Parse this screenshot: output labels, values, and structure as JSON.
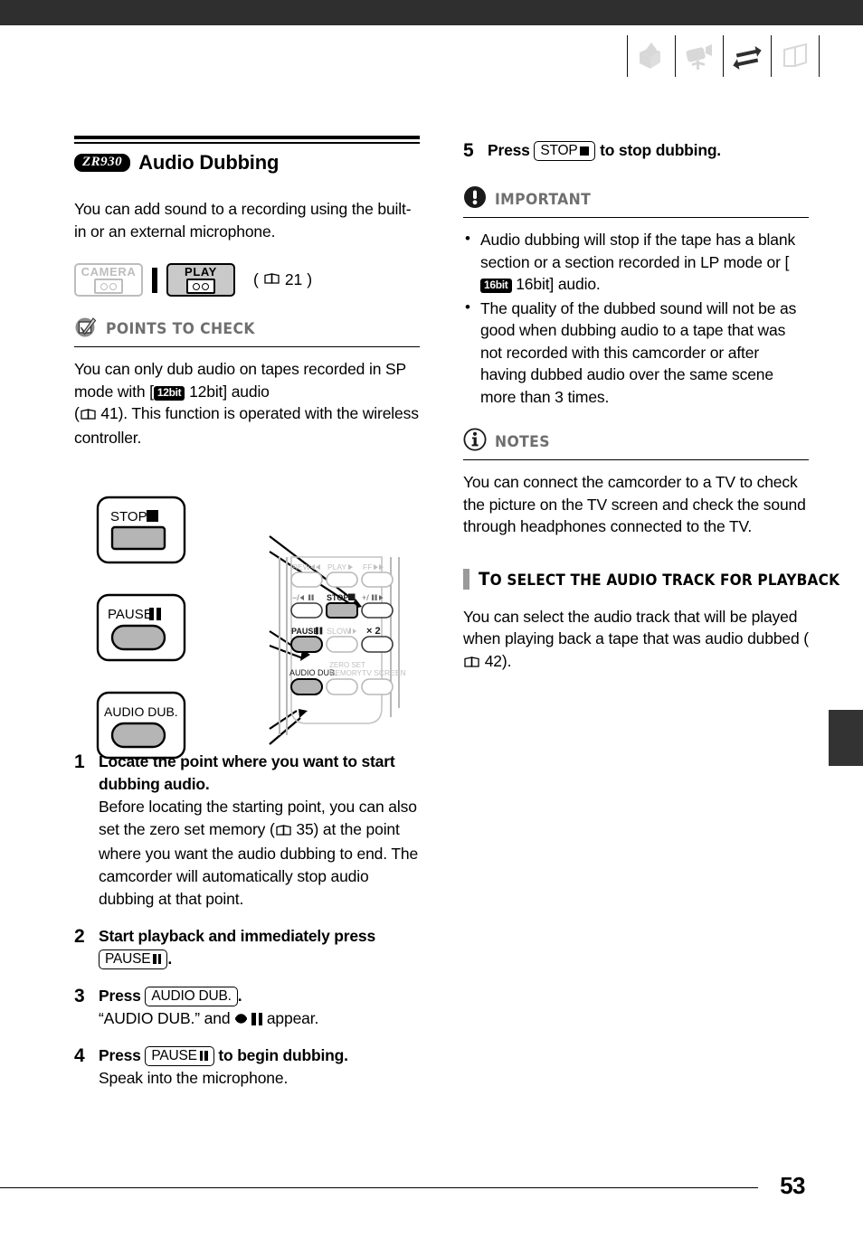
{
  "page": {
    "number": "53",
    "header_icons": [
      {
        "name": "unpack-box-icon",
        "state": "inactive"
      },
      {
        "name": "camcorder-icon",
        "state": "inactive"
      },
      {
        "name": "transfer-arrows-icon",
        "state": "active"
      },
      {
        "name": "open-book-icon",
        "state": "inactive"
      }
    ]
  },
  "left": {
    "model_badge": "ZR930",
    "section_title": "Audio Dubbing",
    "intro": "You can add sound to a recording using the built-in or an external microphone.",
    "modes": {
      "camera_label": "CAMERA",
      "play_label": "PLAY",
      "active": "PLAY",
      "page_ref": "21",
      "paren_open": "(",
      "paren_close": ")"
    },
    "points_to_check": {
      "heading": "POINTS TO CHECK",
      "icon": "checkbox-check-icon",
      "text_a": "You can only dub audio on tapes recorded in SP mode with [",
      "badge": "12bit",
      "text_b": " 12bit] audio",
      "text_c": "(",
      "page_ref": "41",
      "text_d": "). This function is operated with the wireless controller."
    },
    "remote": {
      "callout_stop": "STOP",
      "callout_pause": "PAUSE",
      "callout_audio_dub": "AUDIO DUB.",
      "keys": {
        "rew": "REW",
        "play": "PLAY",
        "ff": "FF",
        "minus": "−/",
        "stop": "STOP",
        "plus": "+/",
        "pause": "PAUSE",
        "slow": "SLOW",
        "x2": "× 2",
        "audio_dub": "AUDIO DUB.",
        "zero_set": "ZERO SET",
        "memory": "MEMORY",
        "tv_screen": "TV SCREEN"
      }
    },
    "steps": [
      {
        "num": "1",
        "title": "Locate the point where you want to start dubbing audio.",
        "desc_a": "Before locating the starting point, you can also set the zero set memory (",
        "page_ref": "35",
        "desc_b": ") at the point where you want the audio dubbing to end. The camcorder will automatically stop audio dubbing at that point."
      },
      {
        "num": "2",
        "title_a": "Start playback and immediately press ",
        "chip": "PAUSE",
        "title_b": "."
      },
      {
        "num": "3",
        "title_a": "Press ",
        "chip": "AUDIO DUB.",
        "title_b": ".",
        "desc_a": "“AUDIO DUB.” and ",
        "desc_b": " appear."
      },
      {
        "num": "4",
        "title_a": "Press ",
        "chip": "PAUSE",
        "title_b": " to begin dubbing.",
        "desc": "Speak into the microphone."
      }
    ]
  },
  "right": {
    "step5": {
      "num": "5",
      "title_a": "Press ",
      "chip": "STOP",
      "title_b": " to stop dubbing."
    },
    "important": {
      "heading": "IMPORTANT",
      "icon": "exclamation-circle-icon",
      "bullets": [
        {
          "text_a": "Audio dubbing will stop if the tape has a blank section or a section recorded in LP mode or [",
          "badge": "16bit",
          "text_b": " 16bit] audio."
        },
        {
          "text_a": "The quality of the dubbed sound will not be as good when dubbing audio to a tape that was not recorded with this camcorder or after having dubbed audio over the same scene more than 3 times."
        }
      ]
    },
    "notes": {
      "heading": "NOTES",
      "icon": "info-circle-icon",
      "text": "You can connect the camcorder to a TV to check the picture on the TV screen and check the sound through headphones connected to the TV."
    },
    "subsection": {
      "heading_first": "T",
      "heading_rest": "O SELECT THE AUDIO TRACK FOR PLAYBACK",
      "text_a": "You can select the audio track that will be played when playing back a tape that was audio dubbed (",
      "page_ref": "42",
      "text_b": ")."
    }
  },
  "colors": {
    "top_bar": "#2f2f2f",
    "heading_gray": "#6f6f6f",
    "button_gray": "#c0c0c0",
    "inactive_gray": "#d8d8d8",
    "edge_tab": "#333333"
  }
}
